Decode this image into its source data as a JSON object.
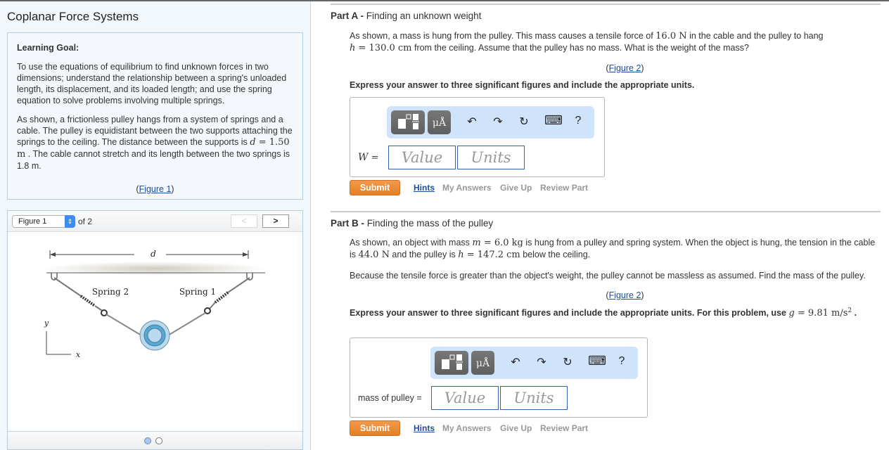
{
  "page": {
    "title": "Coplanar Force Systems"
  },
  "learning_goal": {
    "heading": "Learning Goal:",
    "paragraph1": "To use the equations of equilibrium to find unknown forces in two dimensions; understand the relationship between a spring's unloaded length, its displacement, and its loaded length; and use the spring equation to solve problems involving multiple springs.",
    "paragraph2_a": "As shown, a frictionless pulley hangs from a system of springs and a cable. The pulley is equidistant between the two supports attaching the springs to the ceiling. The distance between the supports is ",
    "paragraph2_var": "d",
    "paragraph2_eq": " = 1.50 m",
    "paragraph2_b": " . The cable cannot stretch and its length between the two springs is 1.8 m.",
    "figure_link_open": "(",
    "figure_link": "Figure 1",
    "figure_link_close": ")"
  },
  "figure_panel": {
    "selected": "Figure 1",
    "of_label": "of 2",
    "prev_glyph": "<",
    "next_glyph": ">",
    "current_index": 1,
    "total": 2,
    "labels": {
      "d": "d",
      "spring2": "Spring 2",
      "spring1": "Spring 1",
      "y": "y",
      "x": "x"
    }
  },
  "toolbar": {
    "mu_label": "μÅ",
    "undo_glyph": "↶",
    "redo_glyph": "↷",
    "reset_glyph": "↻",
    "keyboard_glyph": "⌨",
    "help_glyph": "?"
  },
  "part_a": {
    "label": "Part A -",
    "title": " Finding an unknown weight",
    "prompt_1": "As shown, a mass is hung from the pulley. This mass causes a tensile force of ",
    "prompt_force": "16.0 N",
    "prompt_2": " in the cable and the pulley to hang",
    "prompt_h_var": "h",
    "prompt_h_eq": " = 130.0 cm",
    "prompt_3": " from the ceiling. Assume that the pulley has no mass. What is the weight of the mass?",
    "figure_link": "Figure 2",
    "express": "Express your answer to three significant figures and include the appropriate units.",
    "answer_var": "W",
    "answer_eq": " =",
    "value_placeholder": "Value",
    "units_placeholder": "Units",
    "submit": "Submit",
    "hints": "Hints",
    "my_answers": "My Answers",
    "give_up": "Give Up",
    "review_part": "Review Part"
  },
  "part_b": {
    "label": "Part B -",
    "title": " Finding the mass of the pulley",
    "prompt_1": "As shown, an object with mass ",
    "prompt_m_var": "m",
    "prompt_m_eq": " = 6.0 kg",
    "prompt_2": " is hung from a pulley and spring system. When the object is hung, the tension in the cable is ",
    "prompt_tension": "44.0 N",
    "prompt_3": " and the pulley is ",
    "prompt_h_var": "h",
    "prompt_h_eq": " = 147.2 cm",
    "prompt_4": " below the ceiling.",
    "prompt_para2": "Because the tensile force is greater than the object's weight, the pulley cannot be massless as assumed. Find the mass of the pulley.",
    "figure_link": "Figure 2",
    "express": "Express your answer to three significant figures and include the appropriate units. For this problem, use ",
    "g_var": "g",
    "g_eq": " = 9.81 m/s",
    "g_exp": "2",
    "express_end": " .",
    "answer_label": "mass of pulley =",
    "value_placeholder": "Value",
    "units_placeholder": "Units",
    "submit": "Submit",
    "hints": "Hints",
    "my_answers": "My Answers",
    "give_up": "Give Up",
    "review_part": "Review Part"
  }
}
